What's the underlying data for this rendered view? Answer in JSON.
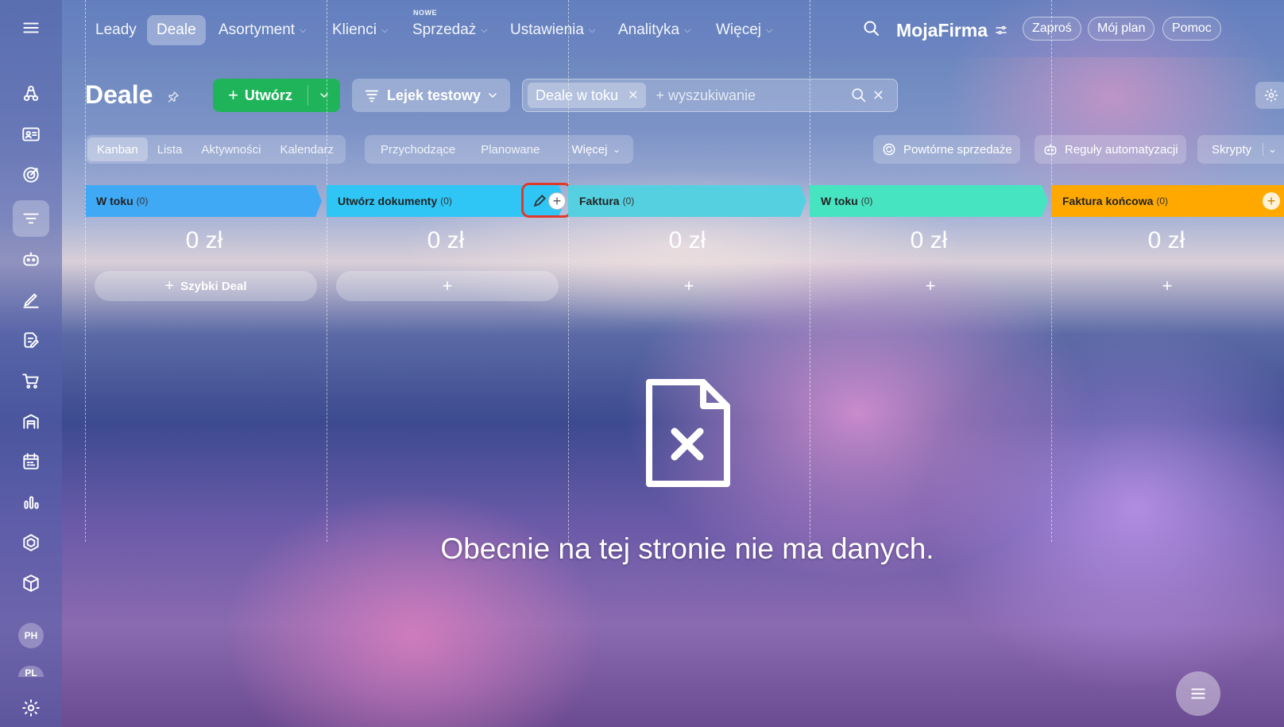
{
  "topnav": {
    "items": [
      {
        "label": "Leady",
        "caret": false
      },
      {
        "label": "Deale",
        "caret": false
      },
      {
        "label": "Asortyment",
        "caret": true
      },
      {
        "label": "Klienci",
        "caret": true
      },
      {
        "label": "Sprzedaż",
        "caret": true,
        "badge": "NOWE"
      },
      {
        "label": "Ustawienia",
        "caret": true
      },
      {
        "label": "Analityka",
        "caret": true
      },
      {
        "label": "Więcej",
        "caret": true
      }
    ],
    "brand": "MojaFirma",
    "pills": [
      "Zaproś",
      "Mój plan",
      "Pomoc"
    ]
  },
  "sidebar": {
    "icons": [
      "menu-icon",
      "leads-icon",
      "contacts-card-icon",
      "target-icon",
      "funnel-icon",
      "robot-icon",
      "sign-icon",
      "document-edit-icon",
      "cart-icon",
      "warehouse-icon",
      "calendar-icon",
      "analytics-icon",
      "hexagon-icon",
      "box-icon"
    ],
    "avatars": [
      "PH",
      "PL"
    ]
  },
  "page": {
    "title": "Deale",
    "create_label": "Utwórz",
    "funnel_label": "Lejek testowy",
    "filter_chip": "Deale w toku",
    "search_placeholder": "+ wyszukiwanie"
  },
  "view_tabs": [
    "Kanban",
    "Lista",
    "Aktywności",
    "Kalendarz"
  ],
  "filter_tabs": [
    "Przychodzące",
    "Planowane",
    "Więcej"
  ],
  "right_buttons": [
    "Powtórne sprzedaże",
    "Reguły automatyzacji",
    "Skrypty"
  ],
  "columns": [
    {
      "title": "W toku",
      "count": "(0)",
      "sum": "0 zł",
      "add_label": "Szybki Deal",
      "color": "#3fa9f5"
    },
    {
      "title": "Utwórz dokumenty",
      "count": "(0)",
      "sum": "0 zł",
      "add_label": "",
      "color": "#2fc6f6"
    },
    {
      "title": "Faktura",
      "count": "(0)",
      "sum": "0 zł",
      "add_label": "",
      "color": "#55d0e0"
    },
    {
      "title": "W toku",
      "count": "(0)",
      "sum": "0 zł",
      "add_label": "",
      "color": "#47e4c2"
    },
    {
      "title": "Faktura końcowa",
      "count": "(0)",
      "sum": "0 zł",
      "add_label": "",
      "color": "#ffa900"
    }
  ],
  "empty_state": {
    "message": "Obecnie na tej stronie nie ma danych."
  },
  "colors": {
    "accent_green": "#1fb45a",
    "highlight_red": "#e0392b"
  }
}
